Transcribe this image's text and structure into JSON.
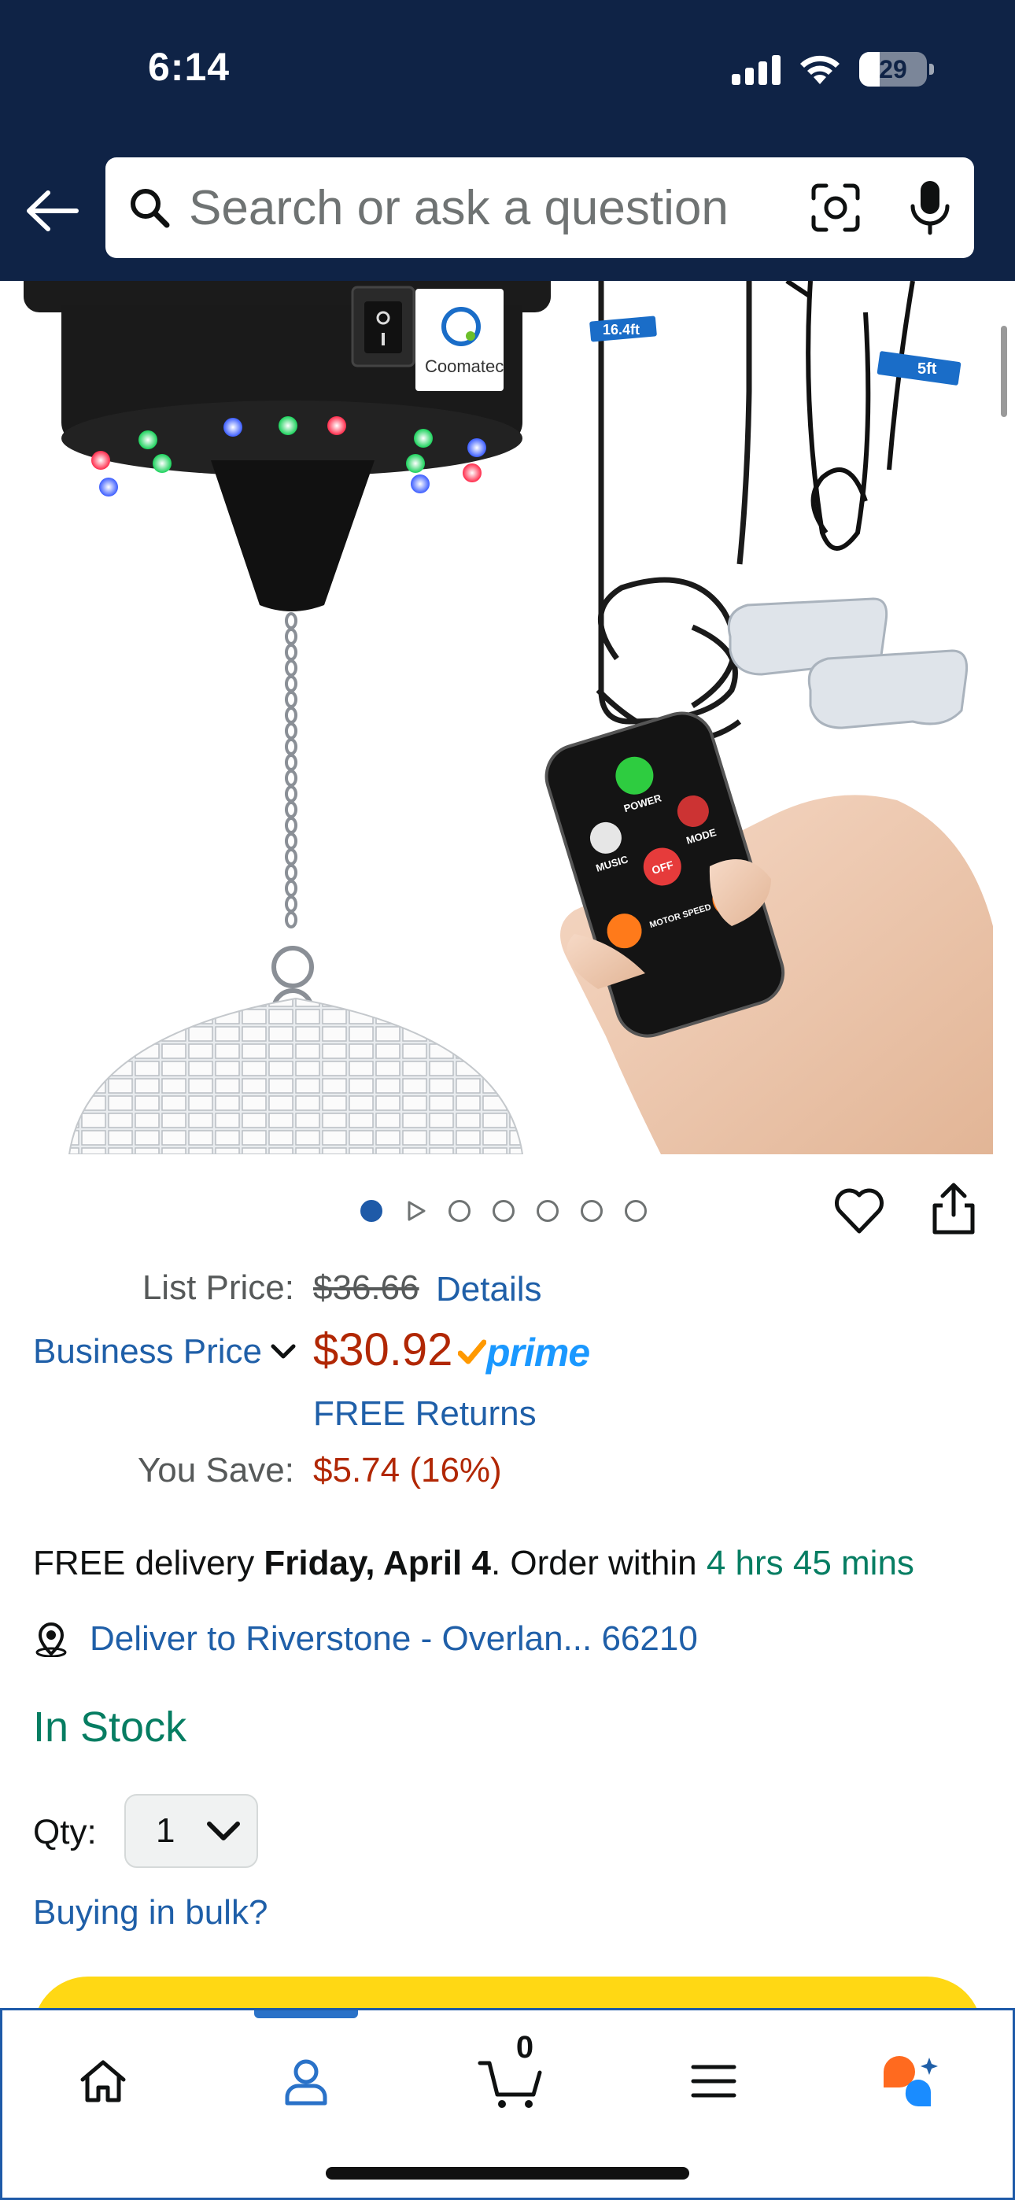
{
  "status_bar": {
    "time": "6:14",
    "battery": "29"
  },
  "search": {
    "placeholder": "Search or ask a question"
  },
  "product": {
    "image_brand": "Coomatec",
    "cable_label_1": "16.4ft",
    "cable_label_2": "5ft",
    "remote_labels": [
      "POWER",
      "MUSIC",
      "MODE",
      "OFF",
      "MOTOR SPEED"
    ]
  },
  "carousel": {
    "count": 7,
    "active_index": 0,
    "video_index": 1
  },
  "price": {
    "list_price_label": "List Price:",
    "list_price_value": "$36.66",
    "details_link": "Details",
    "business_price_label": "Business Price",
    "price": "$30.92",
    "prime_label": "prime",
    "free_returns": "FREE Returns",
    "you_save_label": "You Save:",
    "you_save_value": "$5.74 (16%)"
  },
  "delivery": {
    "prefix": "FREE delivery ",
    "date": "Friday, April 4",
    "middle": ". Order within ",
    "countdown": "4 hrs 45 mins",
    "deliver_to": "Deliver to Riverstone - Overlan... 66210"
  },
  "stock": {
    "status": "In Stock"
  },
  "quantity": {
    "label": "Qty:",
    "value": "1"
  },
  "bulk": {
    "link": "Buying in bulk?"
  },
  "bottom_nav": {
    "cart_count": "0",
    "items": [
      "home-icon",
      "account-icon",
      "cart-icon",
      "menu-icon",
      "rufus-icon"
    ],
    "active": "account-icon"
  },
  "colors": {
    "header_bg": "#0f2346",
    "link": "#1f5fa8",
    "price_red": "#b12704",
    "stock_green": "#067d62",
    "add_to_cart_yellow": "#ffd814",
    "prime_blue": "#1a98ff"
  }
}
